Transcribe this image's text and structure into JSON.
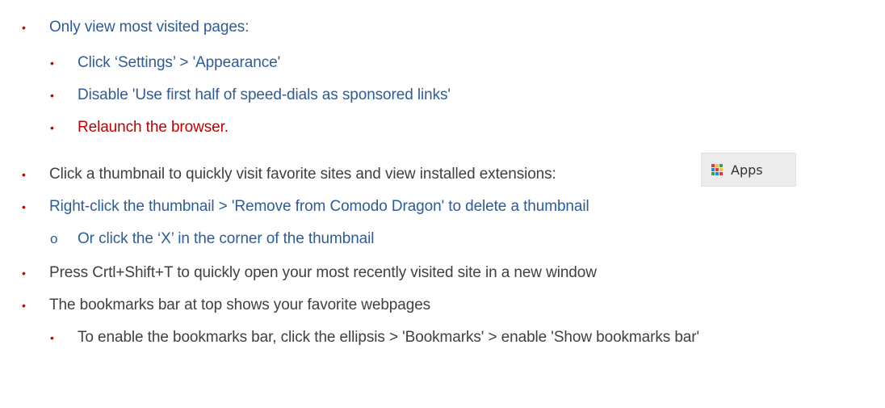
{
  "colors": {
    "bullet": "#cc0000",
    "text_blue": "#2e5c96",
    "text_red": "#c00000",
    "text_dark": "#404040",
    "apps_badge_bg": "#ececec"
  },
  "bullets": {
    "square": "•",
    "circle": "o"
  },
  "items": [
    {
      "text": "Only view most visited pages:"
    },
    {
      "text": "Click ‘Settings’ >  'Appearance'"
    },
    {
      "text": "Disable 'Use first half of speed-dials as sponsored links'"
    },
    {
      "text": "Relaunch the browser."
    },
    {
      "text": "Click a thumbnail to quickly visit favorite sites and view installed extensions:"
    },
    {
      "text": "Right-click the thumbnail > 'Remove from Comodo Dragon' to delete a thumbnail"
    },
    {
      "text": "Or click the ‘X’ in the corner of the thumbnail"
    },
    {
      "text": "Press Crtl+Shift+T to quickly open your most recently visited site in a new window"
    },
    {
      "text": "The bookmarks bar at top shows your favorite webpages"
    },
    {
      "text": "To enable the bookmarks bar, click the ellipsis > 'Bookmarks' > enable 'Show bookmarks bar'"
    }
  ],
  "apps_badge": {
    "label": "Apps",
    "icon": "apps-grid-icon",
    "icon_colors": [
      "#e53935",
      "#fbc02d",
      "#43a047",
      "#1e88e5",
      "#e53935",
      "#fbc02d",
      "#43a047",
      "#1e88e5",
      "#e53935"
    ]
  }
}
